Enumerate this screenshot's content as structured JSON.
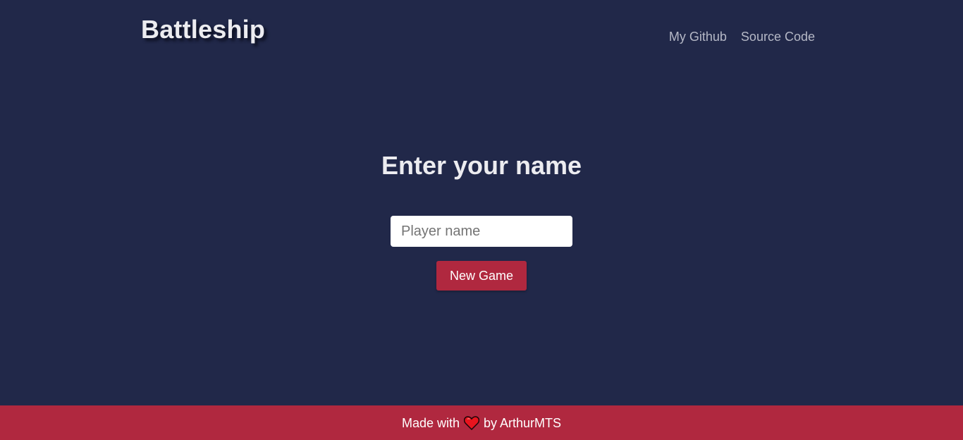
{
  "header": {
    "brand": "Battleship",
    "nav": [
      {
        "label": "My Github"
      },
      {
        "label": "Source Code"
      }
    ]
  },
  "main": {
    "title": "Enter your name",
    "name_input": {
      "placeholder": "Player name",
      "value": ""
    },
    "new_game_label": "New Game"
  },
  "footer": {
    "prefix": "Made with",
    "icon": "heart-icon",
    "suffix": "by ArthurMTS"
  },
  "colors": {
    "background": "#212849",
    "accent": "#b0283f",
    "text": "#ececf0",
    "nav_text": "#b5b8c6"
  }
}
